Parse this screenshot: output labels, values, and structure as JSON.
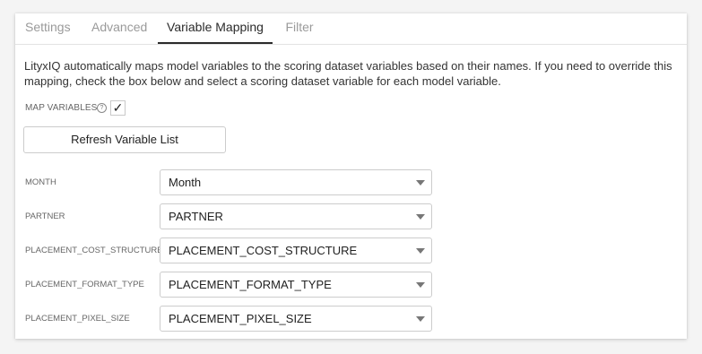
{
  "tabs": [
    {
      "label": "Settings"
    },
    {
      "label": "Advanced"
    },
    {
      "label": "Variable Mapping",
      "active": true
    },
    {
      "label": "Filter"
    }
  ],
  "description": "LityxIQ automatically maps model variables to the scoring dataset variables based on their names. If you need to override this mapping, check the box below and select a scoring dataset variable for each model variable.",
  "map_variables": {
    "label": "MAP VARIABLES",
    "help_icon": "?",
    "checked": true,
    "check_glyph": "✓"
  },
  "refresh_button": {
    "label": "Refresh Variable List"
  },
  "mappings": [
    {
      "variable": "MONTH",
      "selected": "Month"
    },
    {
      "variable": "PARTNER",
      "selected": "PARTNER"
    },
    {
      "variable": "PLACEMENT_COST_STRUCTURE",
      "selected": "PLACEMENT_COST_STRUCTURE"
    },
    {
      "variable": "PLACEMENT_FORMAT_TYPE",
      "selected": "PLACEMENT_FORMAT_TYPE"
    },
    {
      "variable": "PLACEMENT_PIXEL_SIZE",
      "selected": "PLACEMENT_PIXEL_SIZE"
    }
  ]
}
